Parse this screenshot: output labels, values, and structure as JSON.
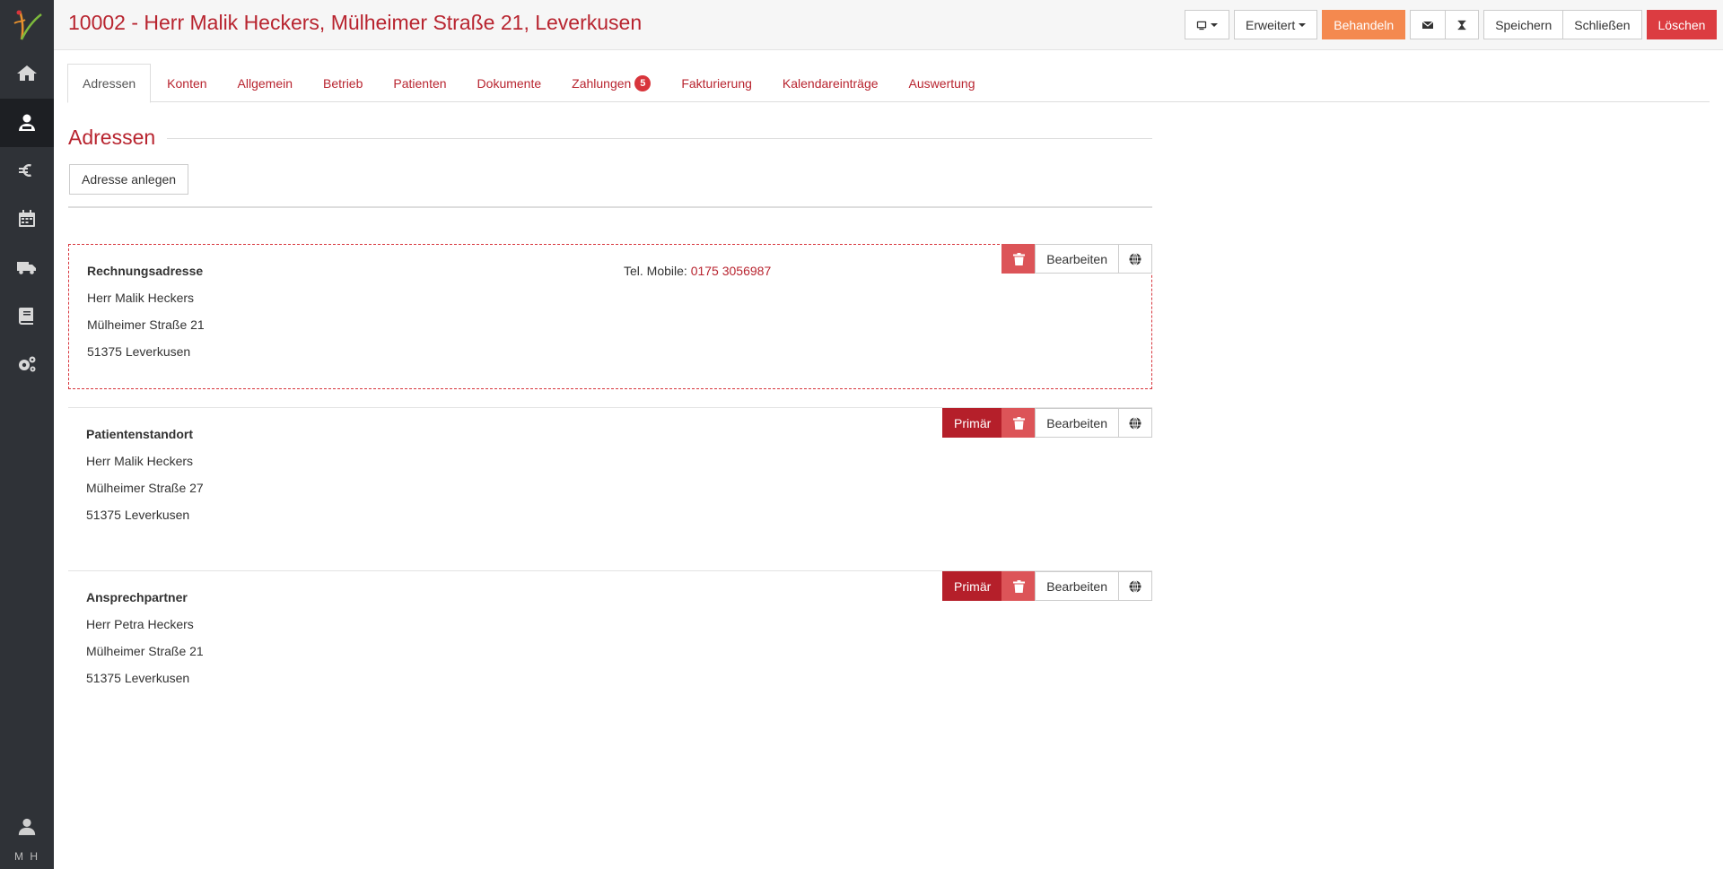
{
  "sidebar": {
    "items": [
      {
        "name": "home-icon"
      },
      {
        "name": "customer-icon"
      },
      {
        "name": "euro-icon"
      },
      {
        "name": "calendar-icon"
      },
      {
        "name": "truck-icon"
      },
      {
        "name": "book-icon"
      },
      {
        "name": "settings-icon"
      }
    ],
    "user_initials": "M H"
  },
  "header": {
    "title": "10002 - Herr Malik Heckers, Mülheimer Straße 21, Leverkusen",
    "buttons": {
      "advanced": "Erweitert",
      "treat": "Behandeln",
      "save": "Speichern",
      "close": "Schließen",
      "delete": "Löschen"
    }
  },
  "tabs": [
    {
      "label": "Adressen",
      "active": true
    },
    {
      "label": "Konten"
    },
    {
      "label": "Allgemein"
    },
    {
      "label": "Betrieb"
    },
    {
      "label": "Patienten"
    },
    {
      "label": "Dokumente"
    },
    {
      "label": "Zahlungen",
      "badge": "5"
    },
    {
      "label": "Fakturierung"
    },
    {
      "label": "Kalendareinträge"
    },
    {
      "label": "Auswertung"
    }
  ],
  "main": {
    "section_title": "Adressen",
    "add_button": "Adresse anlegen",
    "addresses": [
      {
        "type": "Rechnungsadresse",
        "name": "Herr Malik Heckers",
        "street": "Mülheimer Straße 21",
        "city": "51375 Leverkusen",
        "phone_label": "Tel. Mobile:",
        "phone": "0175 3056987",
        "actions": {
          "edit": "Bearbeiten"
        }
      },
      {
        "type": "Patientenstandort",
        "name": "Herr Malik Heckers",
        "street": "Mülheimer Straße 27",
        "city": "51375 Leverkusen",
        "actions": {
          "primary": "Primär",
          "edit": "Bearbeiten"
        }
      },
      {
        "type": "Ansprechpartner",
        "name": "Herr Petra Heckers",
        "street": "Mülheimer Straße 21",
        "city": "51375 Leverkusen",
        "actions": {
          "primary": "Primär",
          "edit": "Bearbeiten"
        }
      }
    ]
  },
  "colors": {
    "accent": "#b8242f",
    "sidebar": "#2f3237",
    "orange": "#f4894f",
    "danger": "#dc3c41"
  }
}
